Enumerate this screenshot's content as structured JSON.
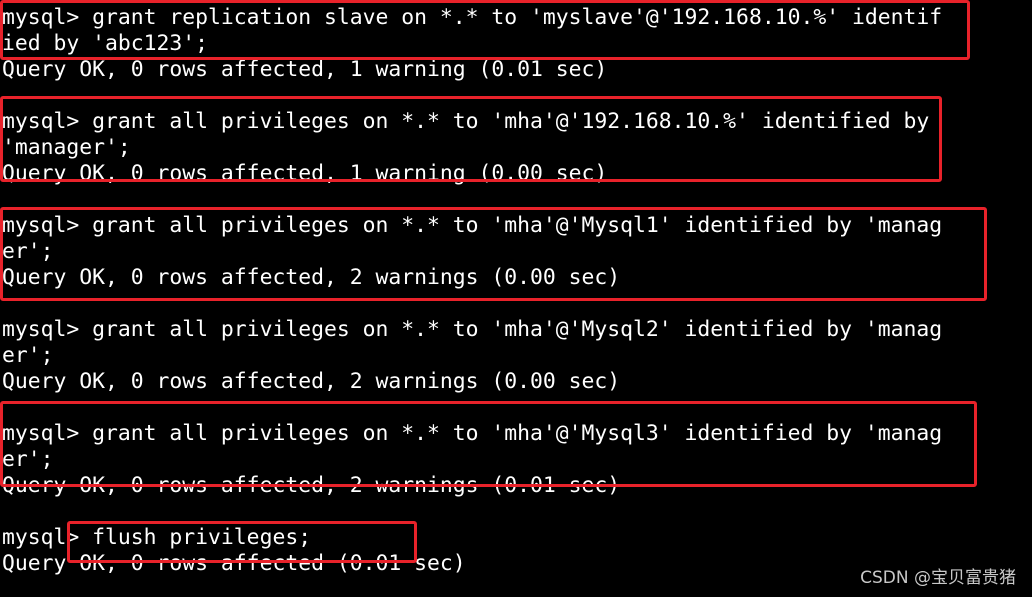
{
  "terminal": {
    "lines": [
      "mysql> grant replication slave on *.* to 'myslave'@'192.168.10.%' identif",
      "ied by 'abc123';",
      "Query OK, 0 rows affected, 1 warning (0.01 sec)",
      "",
      "mysql> grant all privileges on *.* to 'mha'@'192.168.10.%' identified by",
      "'manager';",
      "Query OK, 0 rows affected, 1 warning (0.00 sec)",
      "",
      "mysql> grant all privileges on *.* to 'mha'@'Mysql1' identified by 'manag",
      "er';",
      "Query OK, 0 rows affected, 2 warnings (0.00 sec)",
      "",
      "mysql> grant all privileges on *.* to 'mha'@'Mysql2' identified by 'manag",
      "er';",
      "Query OK, 0 rows affected, 2 warnings (0.00 sec)",
      "",
      "mysql> grant all privileges on *.* to 'mha'@'Mysql3' identified by 'manag",
      "er';",
      "Query OK, 0 rows affected, 2 warnings (0.01 sec)",
      "",
      "mysql> flush privileges;",
      "Query OK, 0 rows affected (0.01 sec)"
    ]
  },
  "watermark": "CSDN @宝贝富贵猪",
  "colors": {
    "background": "#000000",
    "text": "#ffffff",
    "highlight_box": "#e8222a"
  }
}
